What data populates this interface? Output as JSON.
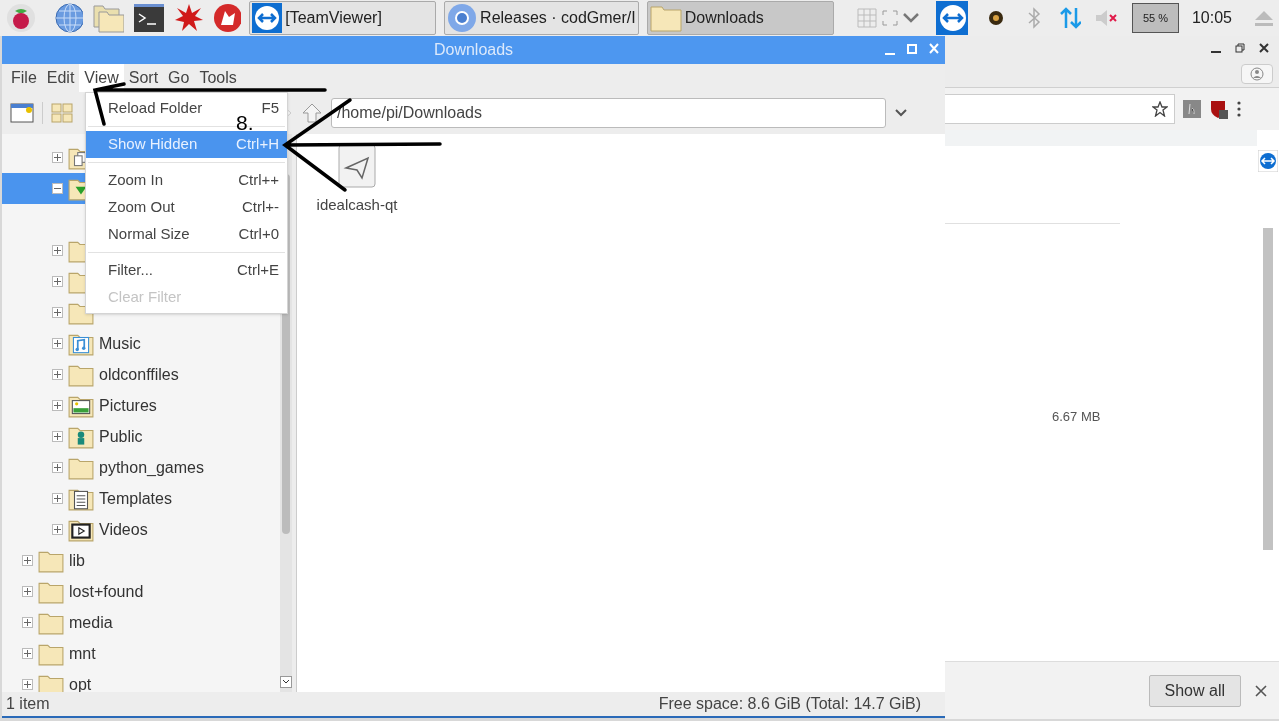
{
  "taskbar": {
    "tasks": [
      {
        "kind": "teamviewer",
        "label": "[TeamViewer]",
        "selected": false
      },
      {
        "kind": "chromium",
        "label": "Releases · codGmer/I",
        "selected": false
      },
      {
        "kind": "folder",
        "label": "Downloads",
        "selected": true
      }
    ],
    "cpu": "55 %",
    "clock": "10:05"
  },
  "window": {
    "title": "Downloads",
    "menu": [
      {
        "label": "File",
        "selected": false
      },
      {
        "label": "Edit",
        "selected": false
      },
      {
        "label": "View",
        "selected": true
      },
      {
        "label": "Sort",
        "selected": false
      },
      {
        "label": "Go",
        "selected": false
      },
      {
        "label": "Tools",
        "selected": false
      }
    ],
    "path": "/home/pi/Downloads",
    "view_menu": [
      {
        "kind": "item",
        "label": "Reload Folder",
        "shortcut": "F5",
        "selected": false,
        "disabled": false
      },
      {
        "kind": "separator"
      },
      {
        "kind": "item",
        "label": "Show Hidden",
        "shortcut": "Ctrl+H",
        "selected": true,
        "disabled": false
      },
      {
        "kind": "separator"
      },
      {
        "kind": "item",
        "label": "Zoom In",
        "shortcut": "Ctrl++",
        "selected": false,
        "disabled": false
      },
      {
        "kind": "item",
        "label": "Zoom Out",
        "shortcut": "Ctrl+-",
        "selected": false,
        "disabled": false
      },
      {
        "kind": "item",
        "label": "Normal Size",
        "shortcut": "Ctrl+0",
        "selected": false,
        "disabled": false
      },
      {
        "kind": "separator"
      },
      {
        "kind": "item",
        "label": "Filter...",
        "shortcut": "Ctrl+E",
        "selected": false,
        "disabled": false
      },
      {
        "kind": "item",
        "label": "Clear Filter",
        "selected": false,
        "disabled": true
      }
    ],
    "tree": [
      {
        "children": [
          {
            "kind": "documents",
            "expanded": false,
            "selected": false
          },
          {
            "kind": "downloads",
            "expanded": true,
            "selected": true
          },
          {
            "kind": "plain",
            "expanded": false,
            "selected": false
          },
          {
            "kind": "plain",
            "expanded": false,
            "selected": false
          },
          {
            "kind": "plain",
            "expanded": false,
            "selected": false
          },
          {
            "kind": "music",
            "label": "Music",
            "expanded": false,
            "selected": false
          },
          {
            "kind": "plain",
            "label": "oldconffiles",
            "expanded": false,
            "selected": false
          },
          {
            "kind": "pictures",
            "label": "Pictures",
            "expanded": false,
            "selected": false
          },
          {
            "kind": "public",
            "label": "Public",
            "expanded": false,
            "selected": false
          },
          {
            "kind": "plain",
            "label": "python_games",
            "expanded": false,
            "selected": false
          },
          {
            "kind": "templates",
            "label": "Templates",
            "expanded": false,
            "selected": false
          },
          {
            "kind": "videos",
            "label": "Videos",
            "expanded": false,
            "selected": false
          }
        ]
      },
      {
        "kind": "plain",
        "label": "lib",
        "expanded": false,
        "selected": false
      },
      {
        "kind": "plain",
        "label": "lost+found",
        "expanded": false,
        "selected": false
      },
      {
        "kind": "plain",
        "label": "media",
        "expanded": false,
        "selected": false
      },
      {
        "kind": "plain",
        "label": "mnt",
        "expanded": false,
        "selected": false
      },
      {
        "kind": "plain",
        "label": "opt",
        "expanded": false,
        "selected": false
      }
    ],
    "files": [
      {
        "name": "idealcash-qt"
      }
    ],
    "status_left": "1 item",
    "status_right": "Free space: 8.6 GiB (Total: 14.7 GiB)"
  },
  "annotation": {
    "step": "8."
  },
  "browser": {
    "download_size": "6.67 MB",
    "show_all": "Show all"
  }
}
